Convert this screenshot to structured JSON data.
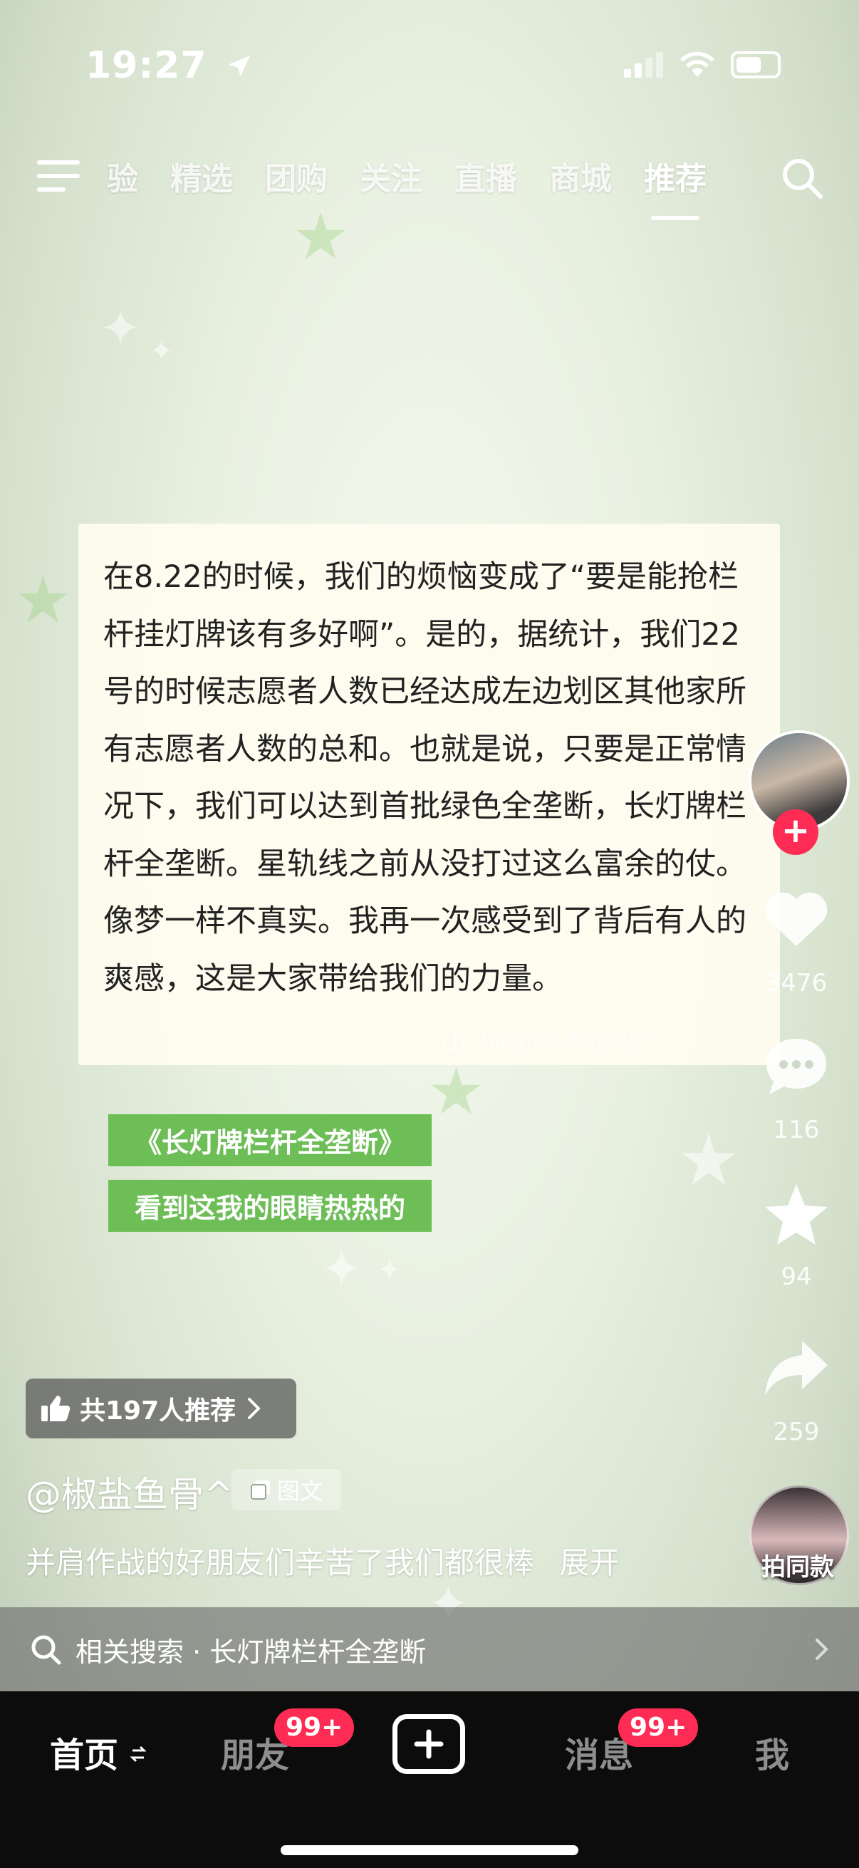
{
  "status_bar": {
    "time": "19:27"
  },
  "top_nav": {
    "tabs": [
      "验",
      "精选",
      "团购",
      "关注",
      "直播",
      "商城",
      "推荐"
    ],
    "active_tab": "推荐"
  },
  "post": {
    "body_text": "在8.22的时候，我们的烦恼变成了“要是能抢栏杆挂灯牌该有多好啊”。是的，据统计，我们22号的时候志愿者人数已经达成左边划区其他家所有志愿者人数的总和。也就是说，只要是正常情况下，我们可以达到首批绿色全垄断，长灯牌栏杆全垄断。星轨线之前从没打过这么富余的仗。像梦一样不真实。我再一次感受到了背后有人的爽感，这是大家带给我们的力量。",
    "watermark": "dr 狗勾学不懂数学",
    "tags": [
      "《长灯牌栏杆全垄断》",
      "看到这我的眼睛热热的"
    ],
    "recommend_label": "共197人推荐",
    "author": "@椒盐鱼骨^",
    "type_label": "图文",
    "caption": "并肩作战的好朋友们辛苦了我们都很棒",
    "expand_label": "展开",
    "related_search": "相关搜索 · 长灯牌栏杆全垄断"
  },
  "rail": {
    "likes": "3476",
    "comments": "116",
    "favorites": "94",
    "shares": "259",
    "same_style_label": "拍同款"
  },
  "bottom_nav": {
    "home": "首页",
    "friends": "朋友",
    "friends_badge": "99+",
    "messages": "消息",
    "messages_badge": "99+",
    "me": "我"
  },
  "colors": {
    "accent": "#fe2c55",
    "tag_green": "#6dbe56"
  },
  "icons": [
    "location-arrow-icon",
    "signal-icon",
    "wifi-icon",
    "battery-icon",
    "menu-icon",
    "search-icon",
    "heart-icon",
    "comment-icon",
    "star-icon",
    "share-icon",
    "thumbs-up-icon",
    "chevron-right-icon",
    "images-icon",
    "plus-icon",
    "refresh-icon"
  ]
}
